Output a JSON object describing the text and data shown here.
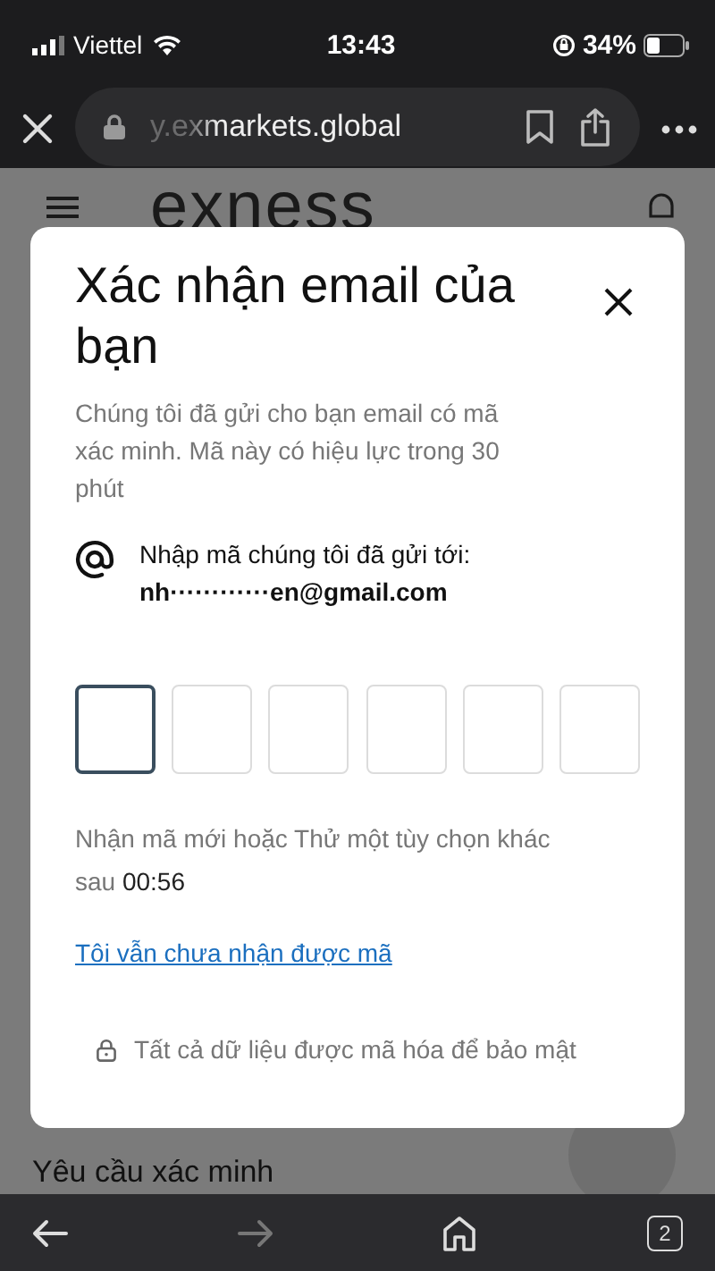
{
  "status_bar": {
    "carrier": "Viettel",
    "time": "13:43",
    "battery": "34%"
  },
  "browser_bar": {
    "address": "y.exmarkets.global"
  },
  "page": {
    "logo": "exness",
    "section_title": "Yêu cầu xác minh"
  },
  "dialog": {
    "title": "Xác nhận email của bạn",
    "description": "Chúng tôi đã gửi cho bạn email có mã xác minh. Mã này có hiệu lực trong 30 phút",
    "sent_to_label": "Nhập mã chúng tôi đã gửi tới:",
    "email": "nh············en@gmail.com",
    "code_boxes": [
      {
        "selected": true
      },
      {
        "selected": false
      },
      {
        "selected": false
      },
      {
        "selected": false
      },
      {
        "selected": false
      },
      {
        "selected": false
      }
    ],
    "resend_text": "Nhận mã mới hoặc Thử một tùy chọn khác sau",
    "countdown": "00:56",
    "link": "Tôi vẫn chưa nhận được mã",
    "security_note": "Tất cả dữ liệu được mã hóa để bảo mật"
  },
  "toolbar": {
    "back_disabled": false,
    "forward_disabled": true,
    "tab_count": "2"
  }
}
